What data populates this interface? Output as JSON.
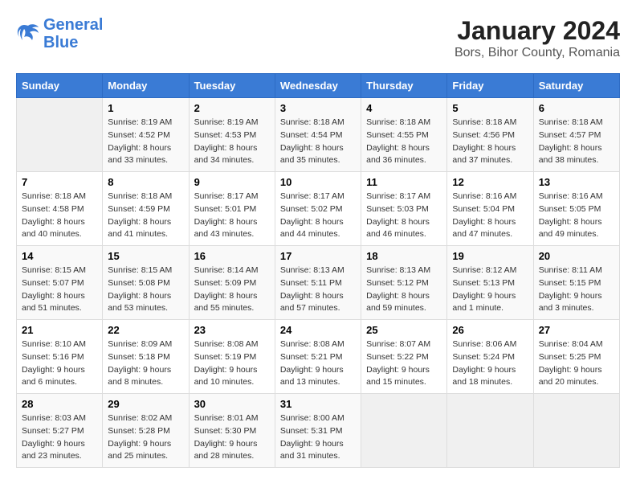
{
  "header": {
    "logo_line1": "General",
    "logo_line2": "Blue",
    "title": "January 2024",
    "subtitle": "Bors, Bihor County, Romania"
  },
  "days_of_week": [
    "Sunday",
    "Monday",
    "Tuesday",
    "Wednesday",
    "Thursday",
    "Friday",
    "Saturday"
  ],
  "weeks": [
    [
      {
        "day": "",
        "sunrise": "",
        "sunset": "",
        "daylight": ""
      },
      {
        "day": "1",
        "sunrise": "Sunrise: 8:19 AM",
        "sunset": "Sunset: 4:52 PM",
        "daylight": "Daylight: 8 hours and 33 minutes."
      },
      {
        "day": "2",
        "sunrise": "Sunrise: 8:19 AM",
        "sunset": "Sunset: 4:53 PM",
        "daylight": "Daylight: 8 hours and 34 minutes."
      },
      {
        "day": "3",
        "sunrise": "Sunrise: 8:18 AM",
        "sunset": "Sunset: 4:54 PM",
        "daylight": "Daylight: 8 hours and 35 minutes."
      },
      {
        "day": "4",
        "sunrise": "Sunrise: 8:18 AM",
        "sunset": "Sunset: 4:55 PM",
        "daylight": "Daylight: 8 hours and 36 minutes."
      },
      {
        "day": "5",
        "sunrise": "Sunrise: 8:18 AM",
        "sunset": "Sunset: 4:56 PM",
        "daylight": "Daylight: 8 hours and 37 minutes."
      },
      {
        "day": "6",
        "sunrise": "Sunrise: 8:18 AM",
        "sunset": "Sunset: 4:57 PM",
        "daylight": "Daylight: 8 hours and 38 minutes."
      }
    ],
    [
      {
        "day": "7",
        "sunrise": "Sunrise: 8:18 AM",
        "sunset": "Sunset: 4:58 PM",
        "daylight": "Daylight: 8 hours and 40 minutes."
      },
      {
        "day": "8",
        "sunrise": "Sunrise: 8:18 AM",
        "sunset": "Sunset: 4:59 PM",
        "daylight": "Daylight: 8 hours and 41 minutes."
      },
      {
        "day": "9",
        "sunrise": "Sunrise: 8:17 AM",
        "sunset": "Sunset: 5:01 PM",
        "daylight": "Daylight: 8 hours and 43 minutes."
      },
      {
        "day": "10",
        "sunrise": "Sunrise: 8:17 AM",
        "sunset": "Sunset: 5:02 PM",
        "daylight": "Daylight: 8 hours and 44 minutes."
      },
      {
        "day": "11",
        "sunrise": "Sunrise: 8:17 AM",
        "sunset": "Sunset: 5:03 PM",
        "daylight": "Daylight: 8 hours and 46 minutes."
      },
      {
        "day": "12",
        "sunrise": "Sunrise: 8:16 AM",
        "sunset": "Sunset: 5:04 PM",
        "daylight": "Daylight: 8 hours and 47 minutes."
      },
      {
        "day": "13",
        "sunrise": "Sunrise: 8:16 AM",
        "sunset": "Sunset: 5:05 PM",
        "daylight": "Daylight: 8 hours and 49 minutes."
      }
    ],
    [
      {
        "day": "14",
        "sunrise": "Sunrise: 8:15 AM",
        "sunset": "Sunset: 5:07 PM",
        "daylight": "Daylight: 8 hours and 51 minutes."
      },
      {
        "day": "15",
        "sunrise": "Sunrise: 8:15 AM",
        "sunset": "Sunset: 5:08 PM",
        "daylight": "Daylight: 8 hours and 53 minutes."
      },
      {
        "day": "16",
        "sunrise": "Sunrise: 8:14 AM",
        "sunset": "Sunset: 5:09 PM",
        "daylight": "Daylight: 8 hours and 55 minutes."
      },
      {
        "day": "17",
        "sunrise": "Sunrise: 8:13 AM",
        "sunset": "Sunset: 5:11 PM",
        "daylight": "Daylight: 8 hours and 57 minutes."
      },
      {
        "day": "18",
        "sunrise": "Sunrise: 8:13 AM",
        "sunset": "Sunset: 5:12 PM",
        "daylight": "Daylight: 8 hours and 59 minutes."
      },
      {
        "day": "19",
        "sunrise": "Sunrise: 8:12 AM",
        "sunset": "Sunset: 5:13 PM",
        "daylight": "Daylight: 9 hours and 1 minute."
      },
      {
        "day": "20",
        "sunrise": "Sunrise: 8:11 AM",
        "sunset": "Sunset: 5:15 PM",
        "daylight": "Daylight: 9 hours and 3 minutes."
      }
    ],
    [
      {
        "day": "21",
        "sunrise": "Sunrise: 8:10 AM",
        "sunset": "Sunset: 5:16 PM",
        "daylight": "Daylight: 9 hours and 6 minutes."
      },
      {
        "day": "22",
        "sunrise": "Sunrise: 8:09 AM",
        "sunset": "Sunset: 5:18 PM",
        "daylight": "Daylight: 9 hours and 8 minutes."
      },
      {
        "day": "23",
        "sunrise": "Sunrise: 8:08 AM",
        "sunset": "Sunset: 5:19 PM",
        "daylight": "Daylight: 9 hours and 10 minutes."
      },
      {
        "day": "24",
        "sunrise": "Sunrise: 8:08 AM",
        "sunset": "Sunset: 5:21 PM",
        "daylight": "Daylight: 9 hours and 13 minutes."
      },
      {
        "day": "25",
        "sunrise": "Sunrise: 8:07 AM",
        "sunset": "Sunset: 5:22 PM",
        "daylight": "Daylight: 9 hours and 15 minutes."
      },
      {
        "day": "26",
        "sunrise": "Sunrise: 8:06 AM",
        "sunset": "Sunset: 5:24 PM",
        "daylight": "Daylight: 9 hours and 18 minutes."
      },
      {
        "day": "27",
        "sunrise": "Sunrise: 8:04 AM",
        "sunset": "Sunset: 5:25 PM",
        "daylight": "Daylight: 9 hours and 20 minutes."
      }
    ],
    [
      {
        "day": "28",
        "sunrise": "Sunrise: 8:03 AM",
        "sunset": "Sunset: 5:27 PM",
        "daylight": "Daylight: 9 hours and 23 minutes."
      },
      {
        "day": "29",
        "sunrise": "Sunrise: 8:02 AM",
        "sunset": "Sunset: 5:28 PM",
        "daylight": "Daylight: 9 hours and 25 minutes."
      },
      {
        "day": "30",
        "sunrise": "Sunrise: 8:01 AM",
        "sunset": "Sunset: 5:30 PM",
        "daylight": "Daylight: 9 hours and 28 minutes."
      },
      {
        "day": "31",
        "sunrise": "Sunrise: 8:00 AM",
        "sunset": "Sunset: 5:31 PM",
        "daylight": "Daylight: 9 hours and 31 minutes."
      },
      {
        "day": "",
        "sunrise": "",
        "sunset": "",
        "daylight": ""
      },
      {
        "day": "",
        "sunrise": "",
        "sunset": "",
        "daylight": ""
      },
      {
        "day": "",
        "sunrise": "",
        "sunset": "",
        "daylight": ""
      }
    ]
  ]
}
